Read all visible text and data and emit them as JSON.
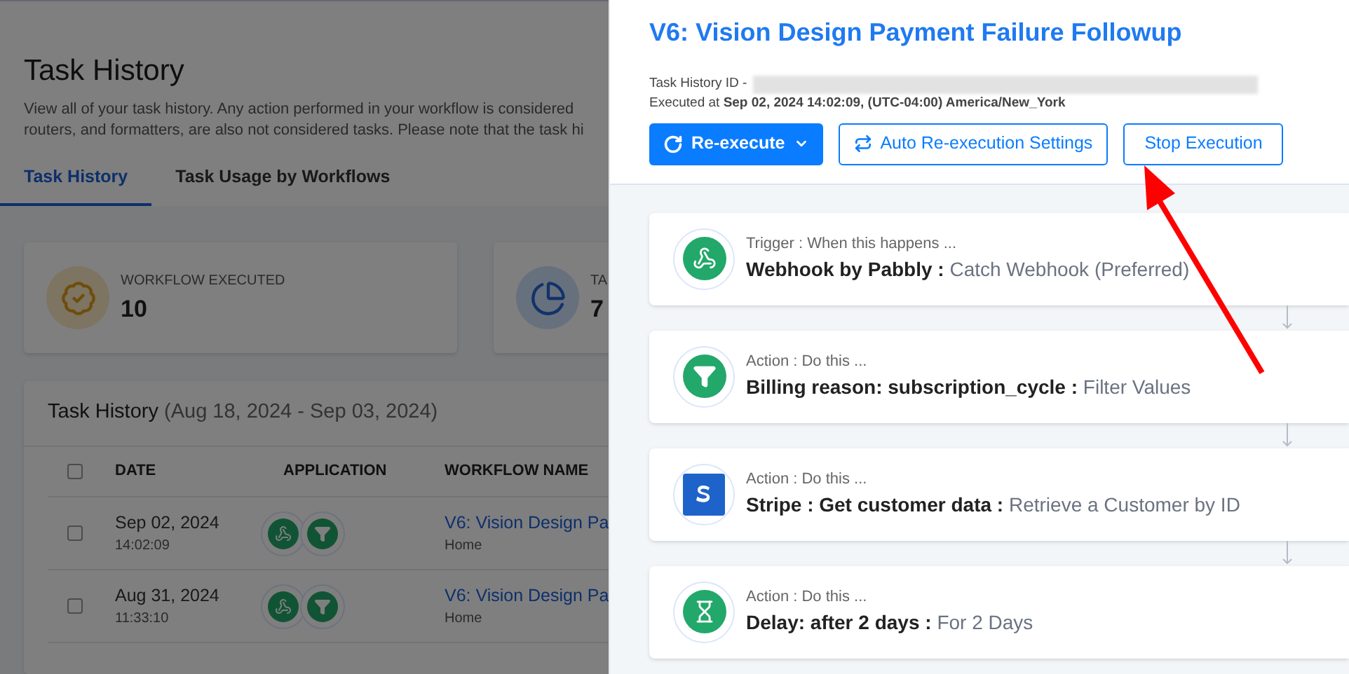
{
  "background_page": {
    "title": "Task History",
    "description_lines": [
      "View all of your task history. Any action performed in your workflow is considered",
      "routers, and formatters, are also not considered tasks. Please note that the task hi"
    ],
    "tabs": [
      {
        "label": "Task History",
        "selected": true
      },
      {
        "label": "Task Usage by Workflows",
        "selected": false
      }
    ],
    "stats": [
      {
        "kind": "badge",
        "label": "WORKFLOW EXECUTED",
        "value": "10"
      },
      {
        "kind": "pie",
        "label": "TA",
        "value": "7"
      }
    ],
    "table": {
      "title": "Task History",
      "range": "(Aug 18, 2024 - Sep 03, 2024)",
      "columns": [
        "DATE",
        "APPLICATION",
        "WORKFLOW NAME"
      ],
      "select_all_checked": false,
      "rows": [
        {
          "checked": false,
          "date": "Sep 02, 2024",
          "time": "14:02:09",
          "apps": [
            {
              "kind": "webhook"
            },
            {
              "kind": "filter"
            }
          ],
          "workflow": "V6: Vision Design Pa",
          "folder": "Home"
        },
        {
          "checked": false,
          "date": "Aug 31, 2024",
          "time": "11:33:10",
          "apps": [
            {
              "kind": "webhook"
            },
            {
              "kind": "filter"
            }
          ],
          "workflow": "V6: Vision Design Pa",
          "folder": "Home"
        }
      ]
    }
  },
  "panel": {
    "title": "V6: Vision Design Payment Failure Followup",
    "task_history_id_label": "Task History ID -",
    "executed": "Executed at **Sep 02, 2024 14:02:09, (UTC-04:00) America/New_York**",
    "buttons": [
      {
        "kind": "dropdown",
        "label": "Re-execute"
      },
      {
        "kind": "repeat",
        "label": "Auto Re-execution Settings"
      },
      {
        "kind": "plain",
        "label": "Stop Execution"
      }
    ],
    "steps": [
      {
        "kind": "webhook",
        "label": "Trigger : When this happens ...",
        "app": "Webhook by Pabbly :",
        "event": "Catch Webhook (Preferred)"
      },
      {
        "kind": "filter",
        "label": "Action : Do this ...",
        "app": "Billing reason: subscription_cycle :",
        "event": "Filter Values"
      },
      {
        "kind": "stripe",
        "label": "Action : Do this ...",
        "app": "Stripe : Get customer data :",
        "event": "Retrieve a Customer by ID"
      },
      {
        "kind": "delay",
        "label": "Action : Do this ...",
        "app": "Delay: after 2 days :",
        "event": "For 2 Days"
      }
    ]
  }
}
